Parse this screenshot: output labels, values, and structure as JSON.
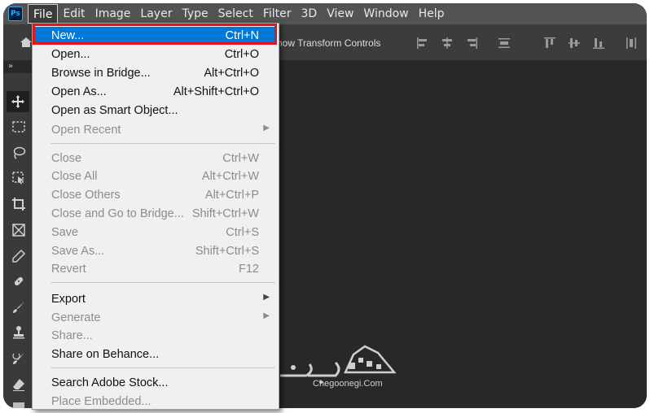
{
  "app": {
    "logo": "Ps"
  },
  "menubar": {
    "items": [
      {
        "label": "File",
        "active": true
      },
      {
        "label": "Edit"
      },
      {
        "label": "Image"
      },
      {
        "label": "Layer"
      },
      {
        "label": "Type"
      },
      {
        "label": "Select"
      },
      {
        "label": "Filter"
      },
      {
        "label": "3D"
      },
      {
        "label": "View"
      },
      {
        "label": "Window"
      },
      {
        "label": "Help"
      }
    ]
  },
  "options_bar": {
    "home_icon": "home-icon",
    "transform_label": "how Transform Controls",
    "align_icons": [
      "align-left-edges-icon",
      "align-horizontal-centers-icon",
      "align-right-edges-icon",
      "distribute-icon",
      "align-top-edges-icon",
      "align-vertical-centers-icon",
      "align-bottom-edges-icon",
      "distribute-vertical-icon"
    ]
  },
  "toolbar": {
    "collapse": "»",
    "tools": [
      "move-tool-icon",
      "marquee-tool-icon",
      "lasso-tool-icon",
      "object-select-tool-icon",
      "crop-tool-icon",
      "frame-tool-icon",
      "eyedropper-tool-icon",
      "healing-brush-tool-icon",
      "brush-tool-icon",
      "clone-stamp-tool-icon",
      "history-brush-tool-icon",
      "eraser-tool-icon",
      "gradient-tool-icon"
    ]
  },
  "file_menu": {
    "items": [
      {
        "label": "New...",
        "shortcut": "Ctrl+N",
        "highlighted": true
      },
      {
        "label": "Open...",
        "shortcut": "Ctrl+O"
      },
      {
        "label": "Browse in Bridge...",
        "shortcut": "Alt+Ctrl+O"
      },
      {
        "label": "Open As...",
        "shortcut": "Alt+Shift+Ctrl+O"
      },
      {
        "label": "Open as Smart Object...",
        "shortcut": ""
      },
      {
        "label": "Open Recent",
        "shortcut": "",
        "submenu": true,
        "disabled": true
      },
      {
        "separator": true
      },
      {
        "label": "Close",
        "shortcut": "Ctrl+W",
        "disabled": true
      },
      {
        "label": "Close All",
        "shortcut": "Alt+Ctrl+W",
        "disabled": true
      },
      {
        "label": "Close Others",
        "shortcut": "Alt+Ctrl+P",
        "disabled": true
      },
      {
        "label": "Close and Go to Bridge...",
        "shortcut": "Shift+Ctrl+W",
        "disabled": true
      },
      {
        "label": "Save",
        "shortcut": "Ctrl+S",
        "disabled": true
      },
      {
        "label": "Save As...",
        "shortcut": "Shift+Ctrl+S",
        "disabled": true
      },
      {
        "label": "Revert",
        "shortcut": "F12",
        "disabled": true
      },
      {
        "separator": true
      },
      {
        "label": "Export",
        "shortcut": "",
        "submenu": true
      },
      {
        "label": "Generate",
        "shortcut": "",
        "submenu": true,
        "disabled": true
      },
      {
        "label": "Share...",
        "shortcut": "",
        "disabled": true
      },
      {
        "label": "Share on Behance...",
        "shortcut": ""
      },
      {
        "separator": true
      },
      {
        "label": "Search Adobe Stock...",
        "shortcut": ""
      },
      {
        "label": "Place Embedded...",
        "shortcut": "",
        "disabled": true
      }
    ]
  },
  "watermark": {
    "site": "Chegoonegi.Com",
    "brand": "چگونگی"
  },
  "colors": {
    "highlight": "#0078d7",
    "callout_border": "#e3141b",
    "menu_bg": "#f0f0f0"
  }
}
